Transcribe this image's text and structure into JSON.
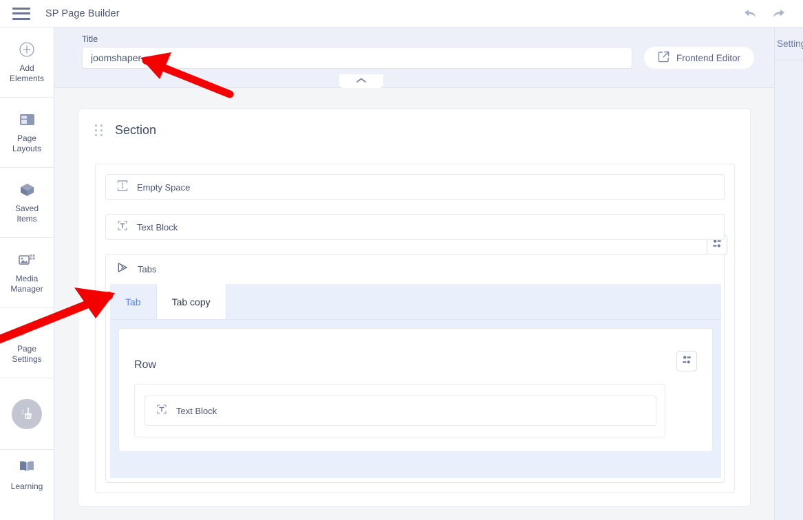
{
  "topbar": {
    "menu_icon": "hamburger-icon",
    "app_title": "SP Page Builder",
    "undo_icon": "undo-icon",
    "redo_icon": "redo-icon"
  },
  "sidebar": {
    "items": [
      {
        "icon": "plus-circle-icon",
        "line1": "Add",
        "line2": "Elements"
      },
      {
        "icon": "page-layouts-icon",
        "line1": "Page",
        "line2": "Layouts"
      },
      {
        "icon": "cube-icon",
        "line1": "Saved",
        "line2": "Items"
      },
      {
        "icon": "media-image-icon",
        "line1": "Media",
        "line2": "Manager"
      },
      {
        "icon": "wrench-icon",
        "line1": "Page",
        "line2": "Settings"
      }
    ],
    "clean": {
      "icon": "broom-clean-icon"
    },
    "learning": {
      "icon": "book-icon",
      "label": "Learning"
    }
  },
  "titlebar": {
    "label": "Title",
    "value": "joomshaper",
    "placeholder": "Title",
    "frontend_button": "Frontend Editor",
    "frontend_icon": "external-link-icon",
    "collapse_icon": "chevron-up-icon"
  },
  "canvas": {
    "section": {
      "drag_handle": "drag-handle-icon",
      "title": "Section",
      "settings_icon": "settings-sliders-icon",
      "elements": [
        {
          "icon": "empty-space-icon",
          "label": "Empty Space"
        },
        {
          "icon": "text-block-icon",
          "label": "Text Block"
        }
      ],
      "tabs_block": {
        "icon": "tabs-icon",
        "label": "Tabs",
        "tabs": [
          {
            "label": "Tab",
            "active": true
          },
          {
            "label": "Tab copy",
            "active": false
          }
        ],
        "row": {
          "title": "Row",
          "settings_icon": "settings-sliders-icon",
          "element": {
            "icon": "text-block-icon",
            "label": "Text Block"
          }
        }
      }
    }
  },
  "right_panel": {
    "title": "Settings"
  },
  "annotations": {
    "arrow_color": "#f40000",
    "arrow_1_target": "title-input",
    "arrow_2_target": "tabs-block"
  },
  "colors": {
    "accent_blue": "#5b7fe8",
    "panel_bg": "#edf0f9",
    "canvas_bg": "#f4f5f7",
    "tab_strip_bg": "#eaf0fb",
    "text": "#4b5675"
  }
}
